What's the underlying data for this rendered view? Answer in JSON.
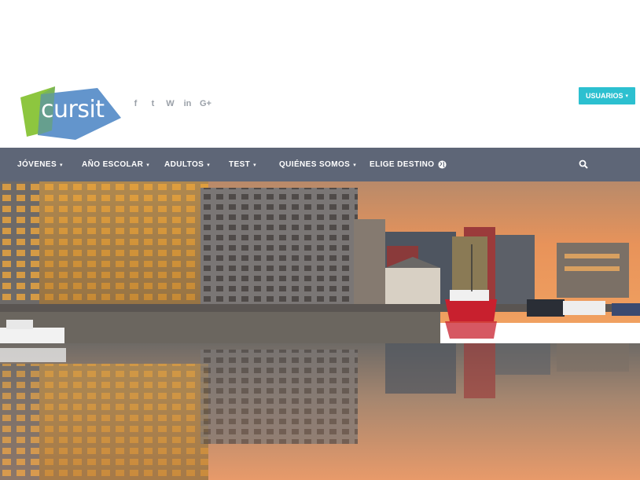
{
  "brand": {
    "logo_text": "cursit"
  },
  "social": [
    {
      "icon": "facebook-icon",
      "glyph": "f"
    },
    {
      "icon": "twitter-icon",
      "glyph": "t"
    },
    {
      "icon": "wordpress-icon",
      "glyph": "W"
    },
    {
      "icon": "linkedin-icon",
      "glyph": "in"
    },
    {
      "icon": "google-plus-icon",
      "glyph": "G+"
    }
  ],
  "header": {
    "users_label": "USUARIOS"
  },
  "nav": {
    "items": [
      {
        "label": "JÓVENES",
        "caret": "▾"
      },
      {
        "label": "AÑO ESCOLAR",
        "caret": "▾"
      },
      {
        "label": "ADULTOS",
        "caret": "▾"
      },
      {
        "label": "TEST",
        "caret": "▾"
      },
      {
        "label": "QUIÉNES SOMOS",
        "caret": "▾"
      },
      {
        "label": "ELIGE DESTINO",
        "icon": "globe-icon"
      }
    ],
    "search_icon": "search-icon"
  },
  "colors": {
    "nav_bg": "#5e6677",
    "accent": "#2cc0d0",
    "logo_green": "#8dc63f",
    "logo_blue": "#5b8fc9"
  }
}
